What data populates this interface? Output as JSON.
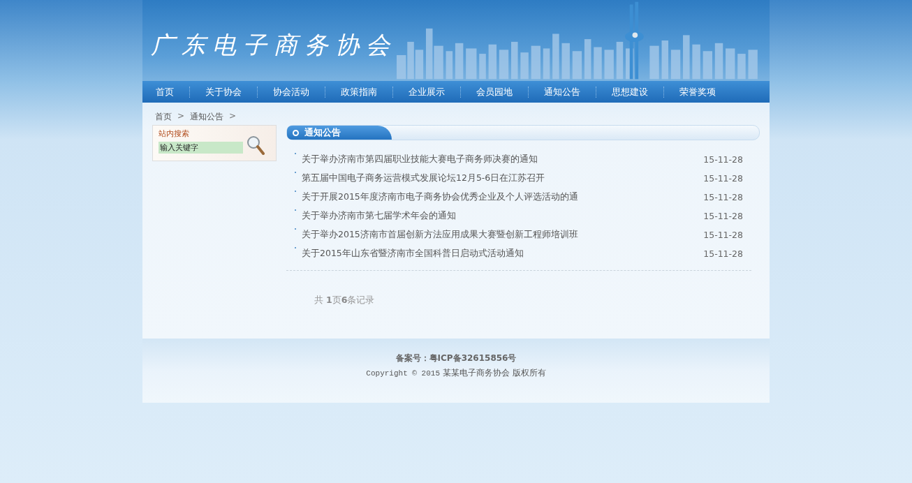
{
  "header": {
    "logo": "广东电子商务协会"
  },
  "nav": [
    "首页",
    "关于协会",
    "协会活动",
    "政策指南",
    "企业展示",
    "会员园地",
    "通知公告",
    "思想建设",
    "荣誉奖项"
  ],
  "breadcrumb": [
    {
      "label": "首页",
      "separator": ">"
    },
    {
      "label": "通知公告",
      "separator": ">"
    }
  ],
  "search": {
    "title": "站内搜索",
    "value": "输入关键字"
  },
  "section": {
    "title": "通知公告"
  },
  "notices": [
    {
      "title": "关于举办济南市第四届职业技能大赛电子商务师决赛的通知",
      "date": "15-11-28"
    },
    {
      "title": "第五届中国电子商务运营模式发展论坛12月5-6日在江苏召开",
      "date": "15-11-28"
    },
    {
      "title": "关于开展2015年度济南市电子商务协会优秀企业及个人评选活动的通",
      "date": "15-11-28"
    },
    {
      "title": "关于举办济南市第七届学术年会的通知",
      "date": "15-11-28"
    },
    {
      "title": "关于举办2015济南市首届创新方法应用成果大赛暨创新工程师培训班",
      "date": "15-11-28"
    },
    {
      "title": "关于2015年山东省暨济南市全国科普日启动式活动通知",
      "date": "15-11-28"
    }
  ],
  "pagination": "共 **1**页**6**条记录",
  "footer": {
    "icp": "备案号：粤ICP备32615856号",
    "copyright_prefix": "Copyright © 2015",
    "copyright": "某某电子商务协会 版权所有"
  }
}
